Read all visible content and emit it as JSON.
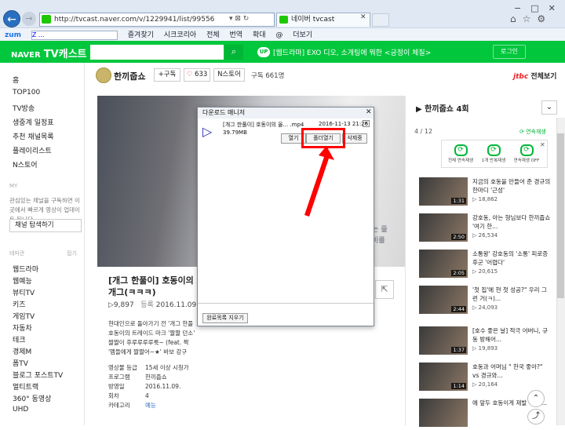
{
  "browser": {
    "address": "http://tvcast.naver.com/v/1229941/list/99556",
    "tab_title": "네이버 tvcast",
    "toolbar": [
      "zum",
      "즐겨찾기",
      "시크코리아",
      "전체",
      "번역",
      "확대",
      "@",
      "더보기"
    ],
    "search_text": "Z ..."
  },
  "header": {
    "logo_brand": "NAVER",
    "logo_service": "TV캐스트",
    "up_badge": "UP",
    "headline": "[웹드라마] EXO 디오, 소개팅에 뭐한 <긍정이 체질>",
    "login": "로그인"
  },
  "nav": {
    "items": [
      "홈",
      "TOP100",
      "TV방송",
      "생중계 일정표",
      "추천 채널목록",
      "플레이리스트",
      "N스토어"
    ],
    "my_section": "MY",
    "my_desc": "관심있는 채널을 구독하면 이 곳에서 빠르게 영상이 업데이트 됩니다.",
    "channel_button": "채널 탐색하기",
    "theme_title": "테마관",
    "theme_setting": "접기",
    "themes": [
      "웹드라마",
      "웹예능",
      "뷰티TV",
      "키즈",
      "게임TV",
      "자동차",
      "테크",
      "경제M",
      "폼TV",
      "블로그 포스트TV",
      "멀티트랙",
      "360° 동영상",
      "UHD"
    ]
  },
  "channel": {
    "name": "한끼줍쇼",
    "subscribe": "+구독",
    "likes": "633",
    "nstore": "N스토어",
    "video_count": "구독 661명",
    "jtbc_brand": "jtbc",
    "jtbc_label": "전체보기"
  },
  "video": {
    "caption": [
      "는 줄",
      "비를"
    ],
    "title_lines": [
      "[개그 한풀이] 호동이의",
      "개그(ㅋㅋㅋ)"
    ],
    "plays": "9,897",
    "date_label": "등록",
    "date": "2016.11.09.",
    "desc_lines": [
      "현대인으로 돌아가기 전 '개그 한풀",
      "호동이의 트레이드 마크 '짤짤 던소'",
      "짤짤이 후루루루루룩~ (feat. 짝",
      "'멤들에게 짤짤어~★' 바보 강구"
    ],
    "meta": [
      {
        "k": "영상물 등급",
        "v": "15세 이상 시청가"
      },
      {
        "k": "프로그램",
        "v": "한끼줍쇼"
      },
      {
        "k": "방영일",
        "v": "2016.11.09."
      },
      {
        "k": "회차",
        "v": "4"
      },
      {
        "k": "카테고리",
        "v": "예능"
      }
    ]
  },
  "playlist": {
    "title": "한끼줍쇼 4회",
    "position": "4 / 12",
    "autoplay": "연속재생",
    "options": [
      "전체 연속재생",
      "1개 반복재생",
      "연속재생 OFF"
    ],
    "items": [
      {
        "title": "지금의 호동을 만들어 준 경규의 한마디 '근성'",
        "views": "18,862",
        "duration": "1:31"
      },
      {
        "title": "강호동, 아는 형님보다 한끼줍쇼 '여기 한...",
        "views": "26,534",
        "duration": "2:50"
      },
      {
        "title": "소통왕' 강호동의 '소통' 피로증후군 '어렵다'",
        "views": "20,615",
        "duration": "2:05"
      },
      {
        "title": "'첫 집'에 현 첫 성공?\" 우리 그런 거(ㅋ)...",
        "views": "24,093",
        "duration": "2:44"
      },
      {
        "title": "[호수 좋은 날] 적극 어버니, 규동 방해어...",
        "views": "19,893",
        "duration": "1:37"
      },
      {
        "title": "호동과 어머님 \" 한국 좋아?\" vs 경규와...",
        "views": "20,164",
        "duration": "1:14"
      },
      {
        "title": "에 앞두 호동이게 제발 해주 ...",
        "views": "",
        "duration": ""
      }
    ]
  },
  "dialog": {
    "title": "다운로드 매니저",
    "file_name": "[개그 한풀이] 호동이의 올... .mp4",
    "file_size": "39.79MB",
    "time": "2016-11-13 21:26",
    "buttons": [
      "열기",
      "폴더열기",
      "삭제중"
    ],
    "clear_button": "완료목록 지우기"
  }
}
